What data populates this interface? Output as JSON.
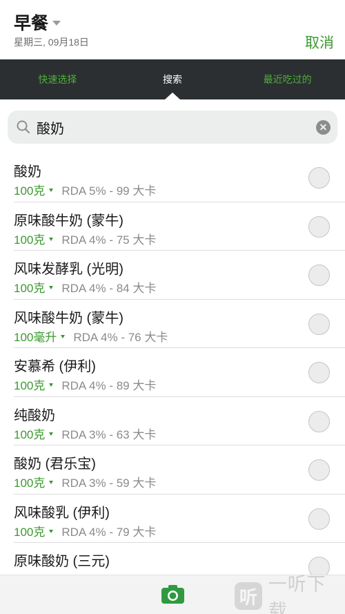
{
  "header": {
    "meal_title": "早餐",
    "date": "星期三, 09月18日",
    "cancel_label": "取消"
  },
  "tabs": [
    {
      "label": "快速选择",
      "active": false
    },
    {
      "label": "搜索",
      "active": true
    },
    {
      "label": "最近吃过的",
      "active": false
    }
  ],
  "search": {
    "value": "酸奶",
    "placeholder": ""
  },
  "results": [
    {
      "name": "酸奶",
      "portion": "100克",
      "rda": "RDA 5% - 99 大卡"
    },
    {
      "name": "原味酸牛奶 (蒙牛)",
      "portion": "100克",
      "rda": "RDA 4% - 75 大卡"
    },
    {
      "name": "风味发酵乳 (光明)",
      "portion": "100克",
      "rda": "RDA 4% - 84 大卡"
    },
    {
      "name": "风味酸牛奶 (蒙牛)",
      "portion": "100毫升",
      "rda": "RDA 4% - 76 大卡"
    },
    {
      "name": "安慕希 (伊利)",
      "portion": "100克",
      "rda": "RDA 4% - 89 大卡"
    },
    {
      "name": "纯酸奶",
      "portion": "100克",
      "rda": "RDA 3% - 63 大卡"
    },
    {
      "name": "酸奶 (君乐宝)",
      "portion": "100克",
      "rda": "RDA 3% - 59 大卡"
    },
    {
      "name": "风味酸乳 (伊利)",
      "portion": "100克",
      "rda": "RDA 4% - 79 大卡"
    },
    {
      "name": "原味酸奶 (三元)",
      "portion": "",
      "rda": ""
    }
  ],
  "watermark": {
    "logo_char": "听",
    "text": "一听下载"
  },
  "colors": {
    "accent_green": "#3a9a2e",
    "tab_bar_bg": "#2b2f31"
  }
}
